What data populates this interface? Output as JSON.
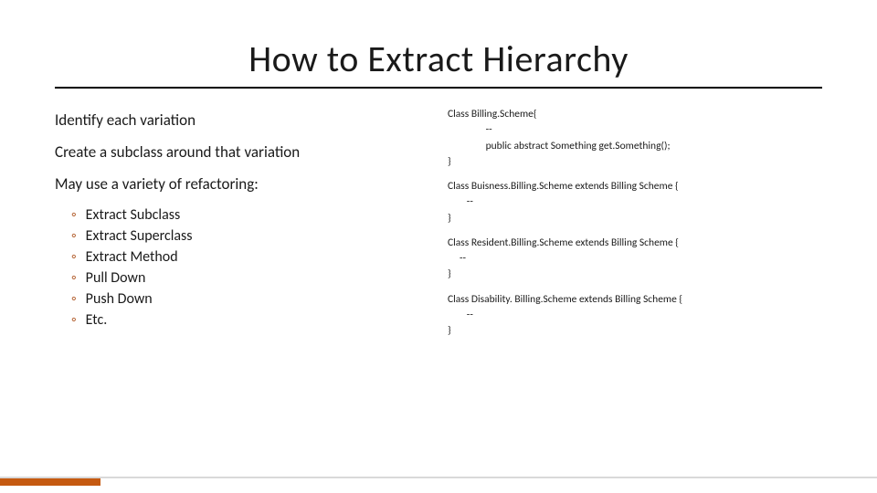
{
  "title": "How to Extract Hierarchy",
  "left": {
    "p1": "Identify each variation",
    "p2": "Create a subclass around that variation",
    "p3": "May use a variety of refactoring:",
    "bullets": [
      "Extract Subclass",
      "Extract Superclass",
      "Extract Method",
      "Pull Down",
      "Push Down",
      "Etc."
    ]
  },
  "code": {
    "c1": "Class Billing.Scheme{\n                --\n                public abstract Something get.Something();\n}",
    "c2": "Class Buisness.Billing.Scheme extends Billing Scheme {\n        --\n}",
    "c3": "Class Resident.Billing.Scheme extends Billing Scheme {\n     --\n}",
    "c4": "Class Disability. Billing.Scheme extends Billing Scheme {\n        --\n}"
  }
}
